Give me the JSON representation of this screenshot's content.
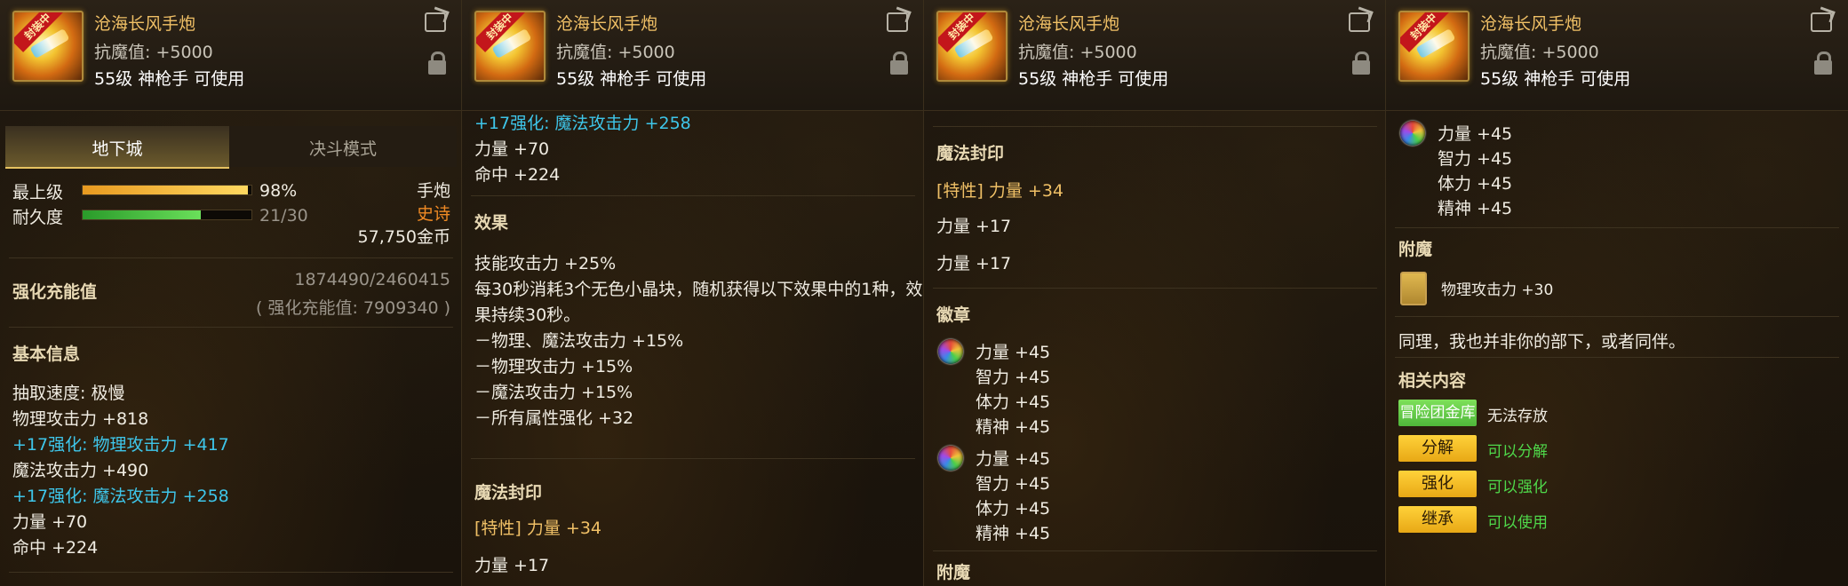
{
  "item": {
    "name": "沧海长风手炮",
    "stat": "抗魔值: +5000",
    "requirement": "55级 神枪手 可使用",
    "icon_tag": "封装中"
  },
  "panel1": {
    "tabs": [
      "地下城",
      "决斗模式"
    ],
    "grade_label": "最上级",
    "grade_value": "98%",
    "grade_fill": 0.98,
    "durability_label": "耐久度",
    "durability_value": "21/30",
    "durability_fill": 0.7,
    "type": "手炮",
    "rarity": "史诗",
    "price": "57,750金币",
    "charge_label": "强化充能值",
    "charge_value": "1874490/2460415",
    "charge_note": "( 强化充能值: 7909340 )",
    "basic_title": "基本信息",
    "basic_lines": [
      {
        "text": "抽取速度: 极慢",
        "color": "white"
      },
      {
        "text": "物理攻击力 +818",
        "color": "white"
      },
      {
        "text": "+17强化: 物理攻击力 +417",
        "color": "cyan"
      },
      {
        "text": "魔法攻击力 +490",
        "color": "white"
      },
      {
        "text": "+17强化: 魔法攻击力 +258",
        "color": "cyan"
      },
      {
        "text": "力量 +70",
        "color": "white"
      },
      {
        "text": "命中 +224",
        "color": "white"
      }
    ]
  },
  "panel2": {
    "top_lines": [
      {
        "text": "+17强化: 魔法攻击力 +258",
        "color": "cyan"
      },
      {
        "text": "力量 +70",
        "color": "white"
      },
      {
        "text": "命中 +224",
        "color": "white"
      }
    ],
    "effect_title": "效果",
    "effect_lines": [
      "技能攻击力 +25%",
      "每30秒消耗3个无色小晶块，随机获得以下效果中的1种，效",
      "果持续30秒。",
      "－物理、魔法攻击力 +15%",
      "－物理攻击力 +15%",
      "－魔法攻击力 +15%",
      "－所有属性强化 +32"
    ],
    "seal_title": "魔法封印",
    "seal_trait": "[特性] 力量 +34",
    "seal_line": "力量 +17"
  },
  "panel3": {
    "seal_title": "魔法封印",
    "seal_trait": "[特性] 力量 +34",
    "seal_lines": [
      "力量 +17",
      "力量 +17"
    ],
    "emblem_title": "徽章",
    "emblem_1": [
      "力量 +45",
      "智力 +45",
      "体力 +45",
      "精神 +45"
    ],
    "emblem_2": [
      "力量 +45",
      "智力 +45",
      "体力 +45",
      "精神 +45"
    ],
    "enchant_title": "附魔"
  },
  "panel4": {
    "emblem": [
      "力量 +45",
      "智力 +45",
      "体力 +45",
      "精神 +45"
    ],
    "enchant_title": "附魔",
    "enchant_line": "物理攻击力 +30",
    "flavor": "同理，我也并非你的部下，或者同伴。",
    "related_title": "相关内容",
    "related": [
      {
        "button": "冒险团金库",
        "text": "无法存放",
        "style": "green"
      },
      {
        "button": "分解",
        "text": "可以分解",
        "style": "yellow"
      },
      {
        "button": "强化",
        "text": "可以强化",
        "style": "yellow"
      },
      {
        "button": "继承",
        "text": "可以使用",
        "style": "yellow"
      }
    ]
  },
  "colors": {
    "title": "#f0c066",
    "cyan": "#3ec6ea",
    "rarity": "#f08a24",
    "available": "#4fd84a"
  }
}
